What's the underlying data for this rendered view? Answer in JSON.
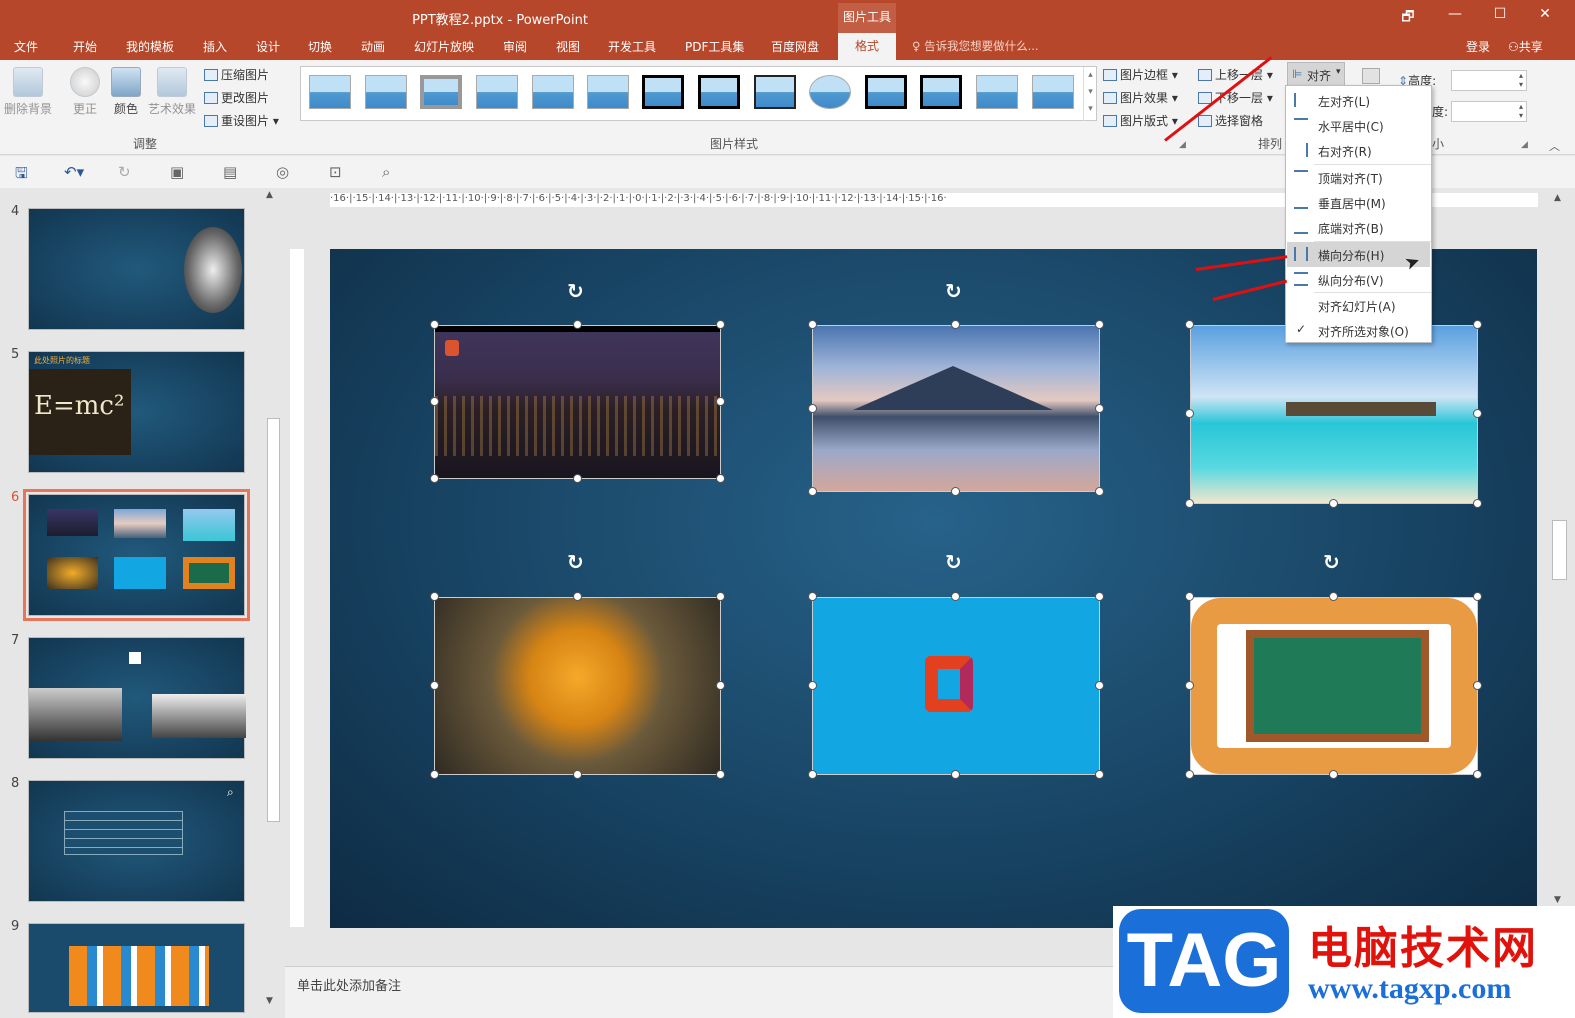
{
  "window": {
    "title": "PPT教程2.pptx - PowerPoint",
    "context_tab": "图片工具",
    "restore": "🗗",
    "minimize": "—",
    "maximize": "☐",
    "close": "✕"
  },
  "tabs": [
    "文件",
    "开始",
    "我的模板",
    "插入",
    "设计",
    "切换",
    "动画",
    "幻灯片放映",
    "审阅",
    "视图",
    "开发工具",
    "PDF工具集",
    "百度网盘"
  ],
  "active_tab": "格式",
  "tell_me": "告诉我您想要做什么...",
  "login": "登录",
  "share": "共享",
  "ribbon": {
    "remove_bg": "删除背景",
    "correct": "更正",
    "color": "颜色",
    "art_effects": "艺术效果",
    "compress": "压缩图片",
    "change_pic": "更改图片",
    "reset_pic": "重设图片",
    "adjust_group": "调整",
    "styles_group": "图片样式",
    "border": "图片边框",
    "effects": "图片效果",
    "layout": "图片版式",
    "bring_forward": "上移一层",
    "send_backward": "下移一层",
    "selection_pane": "选择窗格",
    "arrange_group": "排列",
    "align": "对齐",
    "height_label": "高度:",
    "width_label": "度:",
    "size_group": "小"
  },
  "align_menu": {
    "items": [
      {
        "label": "左对齐(L)"
      },
      {
        "label": "水平居中(C)"
      },
      {
        "label": "右对齐(R)"
      },
      {
        "label": "顶端对齐(T)"
      },
      {
        "label": "垂直居中(M)"
      },
      {
        "label": "底端对齐(B)"
      },
      {
        "label": "横向分布(H)"
      },
      {
        "label": "纵向分布(V)"
      },
      {
        "label": "对齐幻灯片(A)"
      },
      {
        "label": "对齐所选对象(O)"
      }
    ],
    "highlighted": "横向分布(H)",
    "checked": "对齐所选对象(O)",
    "check_mark": "✓"
  },
  "slides": {
    "numbers": [
      "4",
      "5",
      "6",
      "7",
      "8",
      "9"
    ],
    "selected": "6",
    "slide5_title": "此处照片的标题",
    "formula": "E=mc²"
  },
  "ruler": "·16·|·15·|·14·|·13·|·12·|·11·|·10·|·9·|·8·|·7·|·6·|·5·|·4·|·3·|·2·|·1·|·0·|·1·|·2·|·3·|·4·|·5·|·6·|·7·|·8·|·9·|·10·|·11·|·12·|·13·|·14·|·15·|·16·",
  "notes_placeholder": "单击此处添加备注",
  "watermark": {
    "logo": "TAG",
    "cn": "电脑技术网",
    "url": "www.tagxp.com"
  },
  "colors": {
    "accent": "#b7472a",
    "slide_bg": "#174261",
    "selection": "#e8745a",
    "arrow": "#e01010"
  }
}
